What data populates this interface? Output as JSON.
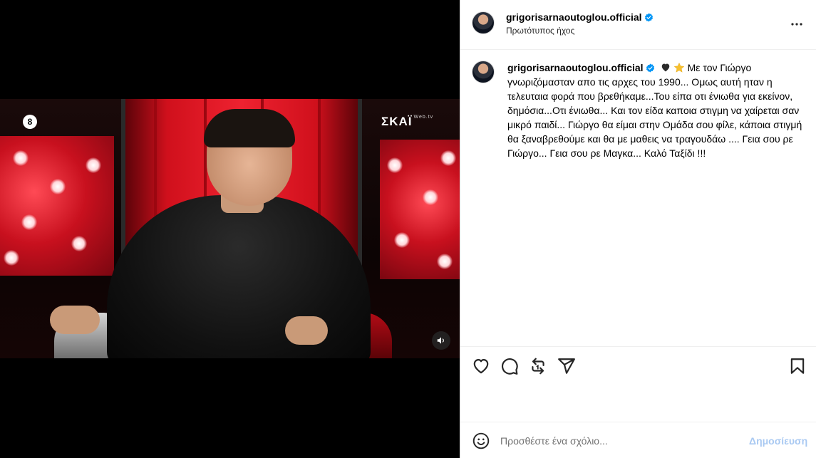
{
  "video": {
    "channel_logo_left": "8",
    "channel_logo_right": "ΣΚΑΪ",
    "channel_logo_right_suffix": "Web.tv"
  },
  "header": {
    "username": "grigorisarnaoutoglou.official",
    "audio_label": "Πρωτότυπος ήχος"
  },
  "caption": {
    "username": "grigorisarnaoutoglou.official",
    "text": "Με τον Γιώργο γνωριζόμασταν απο τις αρχες του 1990... Ομως αυτή ηταν η τελευταια φορά που βρεθήκαμε...Του είπα οτι ένιωθα για εκείνον, δημόσια...Οτι ένιωθα... Και τον είδα καποια στιγμη να χαίρεται σαν μικρό παιδί... Γιώργο θα είμαι στην Ομάδα σου φίλε, κάποια στιγμή θα ξαναβρεθούμε και θα με μαθεις να τραγουδάω .... Γεια σου ρε Γιώργο... Γεια σου ρε Μαγκα... Καλό Ταξίδι !!!"
  },
  "comment": {
    "placeholder": "Προσθέστε ένα σχόλιο...",
    "post_label": "Δημοσίευση"
  },
  "colors": {
    "verified": "#0095f6",
    "post_disabled": "#a9c9f2",
    "chair_red": "#ee2230"
  },
  "icons": [
    "more-icon",
    "verified-icon",
    "heart-icon",
    "comment-icon",
    "repost-icon",
    "share-icon",
    "bookmark-icon",
    "emoji-icon",
    "sound-icon"
  ]
}
